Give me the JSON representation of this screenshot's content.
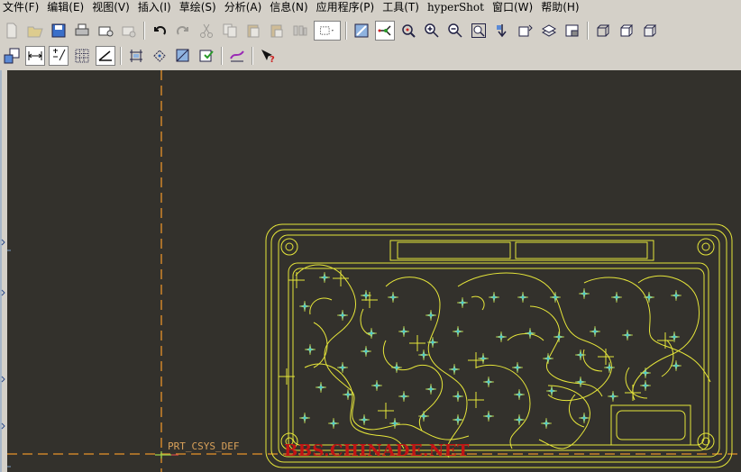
{
  "menu": {
    "file": "文件(F)",
    "edit": "编辑(E)",
    "view": "视图(V)",
    "insert": "插入(I)",
    "sketch": "草绘(S)",
    "analysis": "分析(A)",
    "info": "信息(N)",
    "apps": "应用程序(P)",
    "tools": "工具(T)",
    "hypershot": "hyperShot",
    "window": "窗口(W)",
    "help": "帮助(H)"
  },
  "canvas": {
    "csys_label": "PRT_CSYS_DEF",
    "watermark": "BBS.CHINADE.NET"
  },
  "colors": {
    "canvas_bg": "#33312c",
    "geometry": "#e6e63a",
    "datum_axis": "#e8922a",
    "point": "#49c6d6",
    "watermark": "#c21414"
  },
  "icons": {
    "toolbar1": [
      "new-file-icon",
      "open-file-icon",
      "save-icon",
      "print-icon",
      "send-mail-icon",
      "mail-recipient-icon",
      "undo-icon",
      "redo-icon",
      "cut-icon",
      "copy-icon",
      "paste-icon",
      "paste-special-icon",
      "regenerate-icon",
      "select-box-icon",
      "repaint-icon",
      "spin-center-icon",
      "orient-mode-icon",
      "zoom-in-icon",
      "zoom-out-icon",
      "refit-icon",
      "reorient-icon",
      "saved-views-icon",
      "layers-icon",
      "view-manager-icon",
      "wireframe-icon",
      "hidden-line-icon",
      "no-hidden-icon"
    ],
    "toolbar2": [
      "model-tree-icon",
      "dimension-toggle-icon",
      "tolerance-toggle-icon",
      "grid-icon",
      "datum-toggle-icon",
      "datum-plane-icon",
      "datum-axis-icon",
      "datum-point-icon",
      "csys-icon",
      "analysis-tool-icon",
      "context-help-icon"
    ]
  }
}
